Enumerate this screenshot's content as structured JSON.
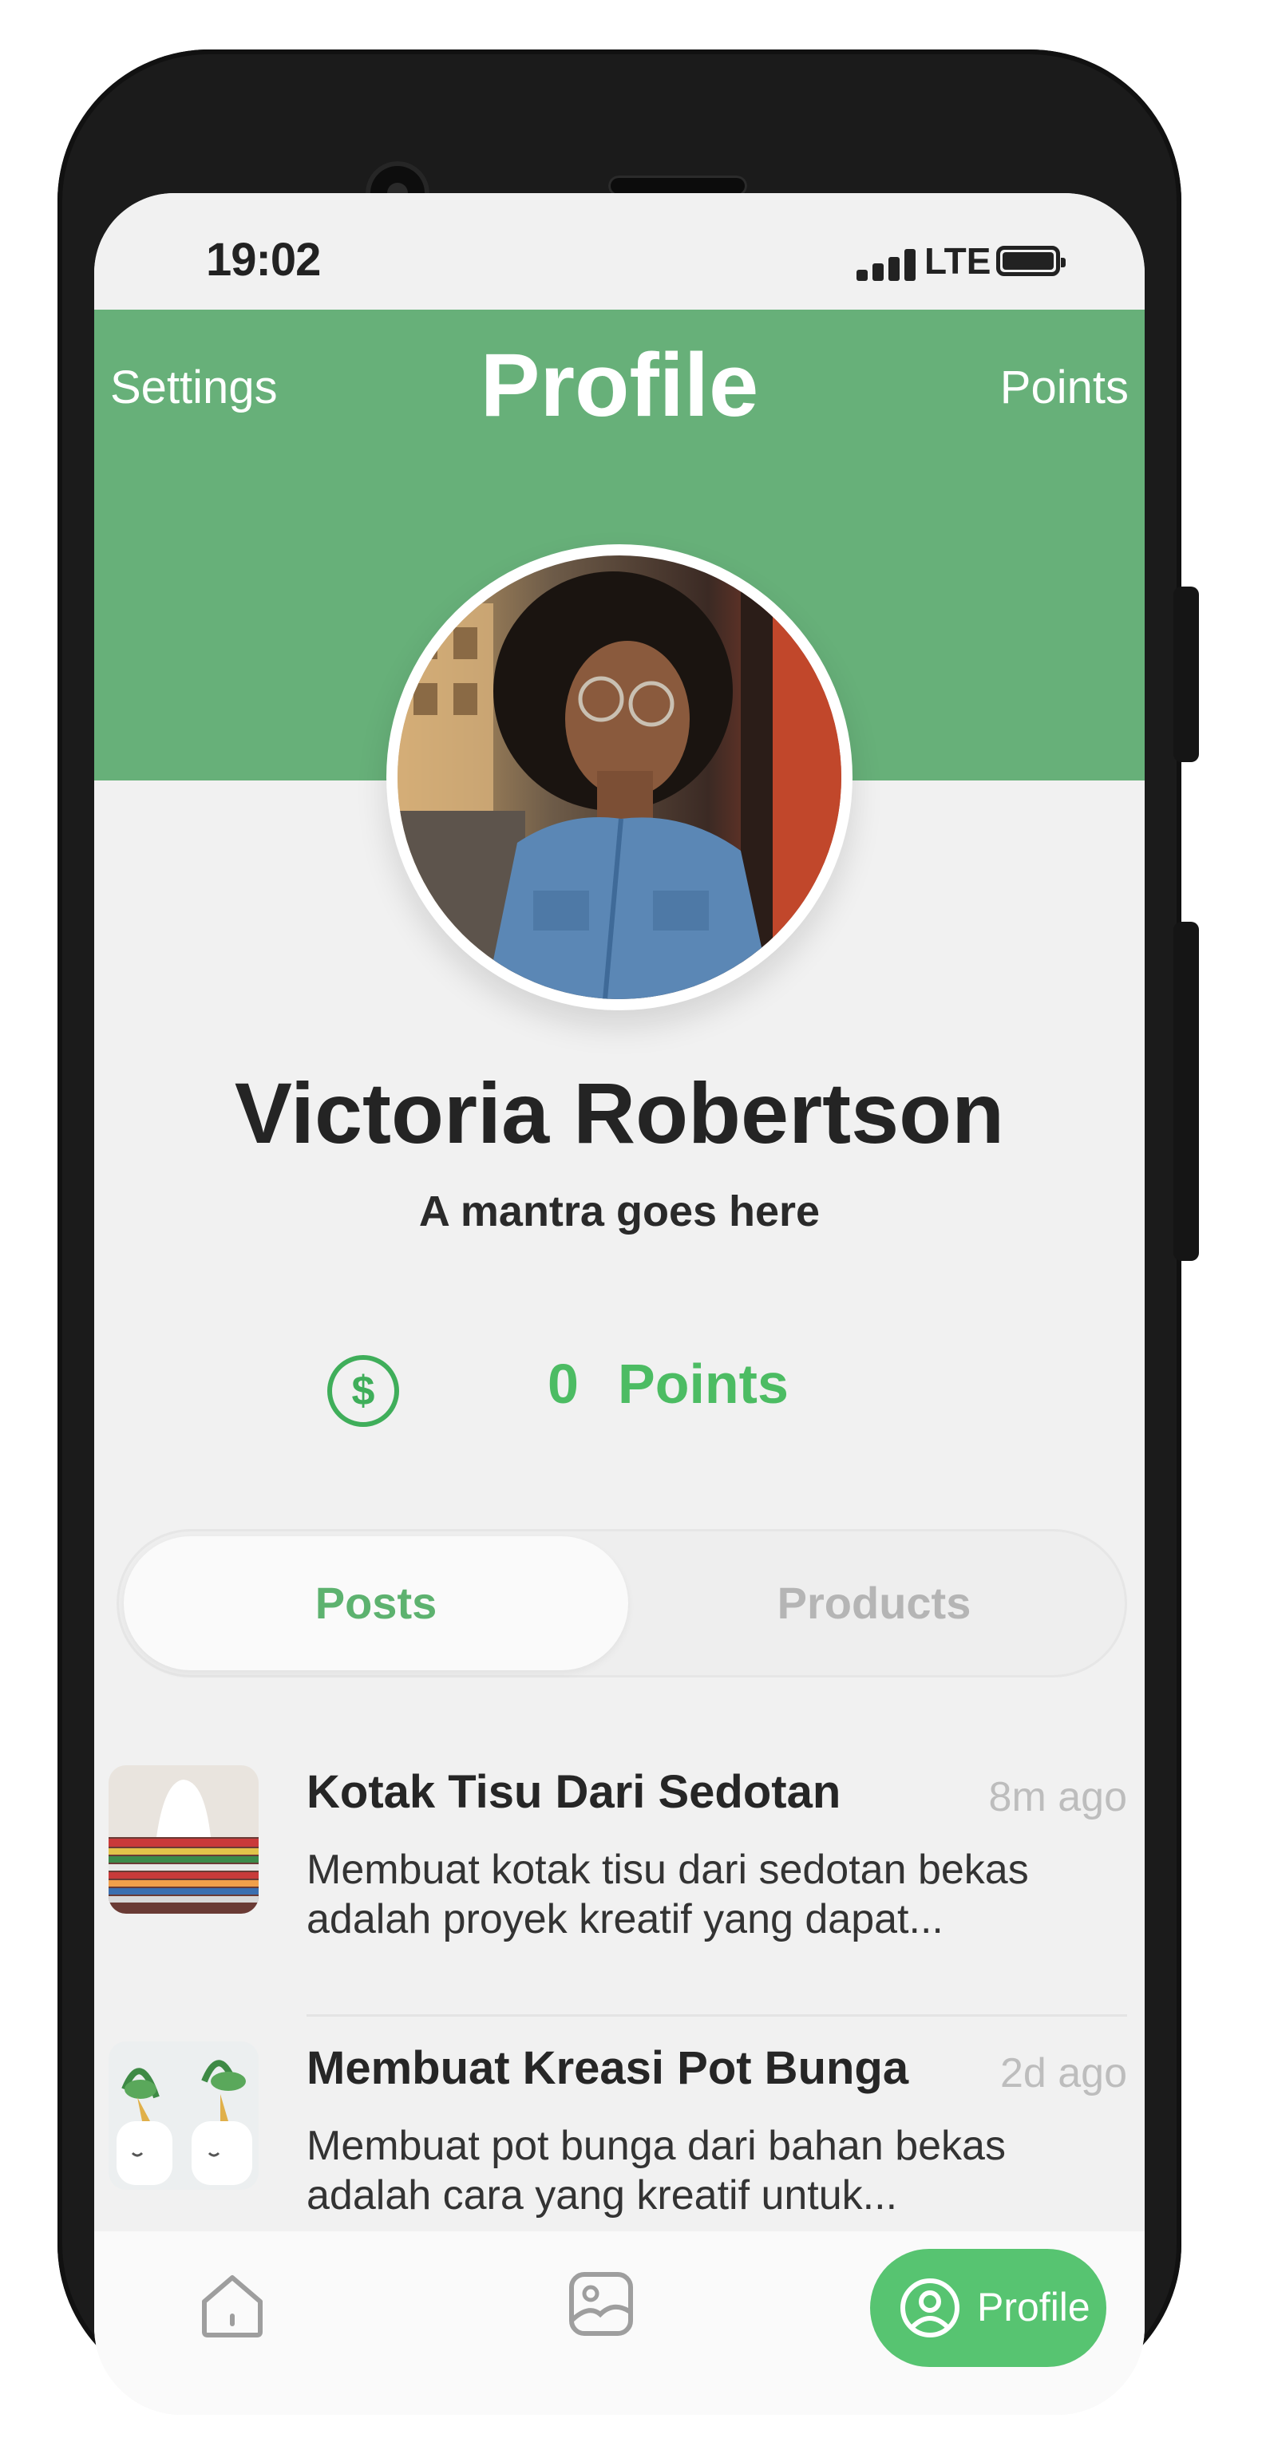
{
  "status_bar": {
    "time": "19:02",
    "network": "LTE"
  },
  "header": {
    "title": "Profile",
    "left_link": "Settings",
    "right_link": "Points",
    "bg_color": "#67b079"
  },
  "profile": {
    "name": "Victoria Robertson",
    "mantra": "A mantra goes here"
  },
  "points": {
    "value": "0",
    "label": "Points",
    "icon": "dollar-circle-icon"
  },
  "tabs": [
    {
      "label": "Posts",
      "active": true
    },
    {
      "label": "Products",
      "active": false
    }
  ],
  "posts": [
    {
      "title": "Kotak Tisu Dari Sedotan",
      "time": "8m ago",
      "desc_line1": "Membuat kotak tisu dari sedotan bekas",
      "desc_line2": "adalah proyek kreatif yang dapat..."
    },
    {
      "title": "Membuat Kreasi Pot Bunga",
      "time": "2d ago",
      "desc_line1": "Membuat pot bunga dari bahan bekas",
      "desc_line2": "adalah cara yang kreatif untuk..."
    }
  ],
  "bottom_nav": {
    "home_icon": "home-icon",
    "gallery_icon": "image-icon",
    "profile_label": "Profile",
    "active_color": "#57c471"
  }
}
